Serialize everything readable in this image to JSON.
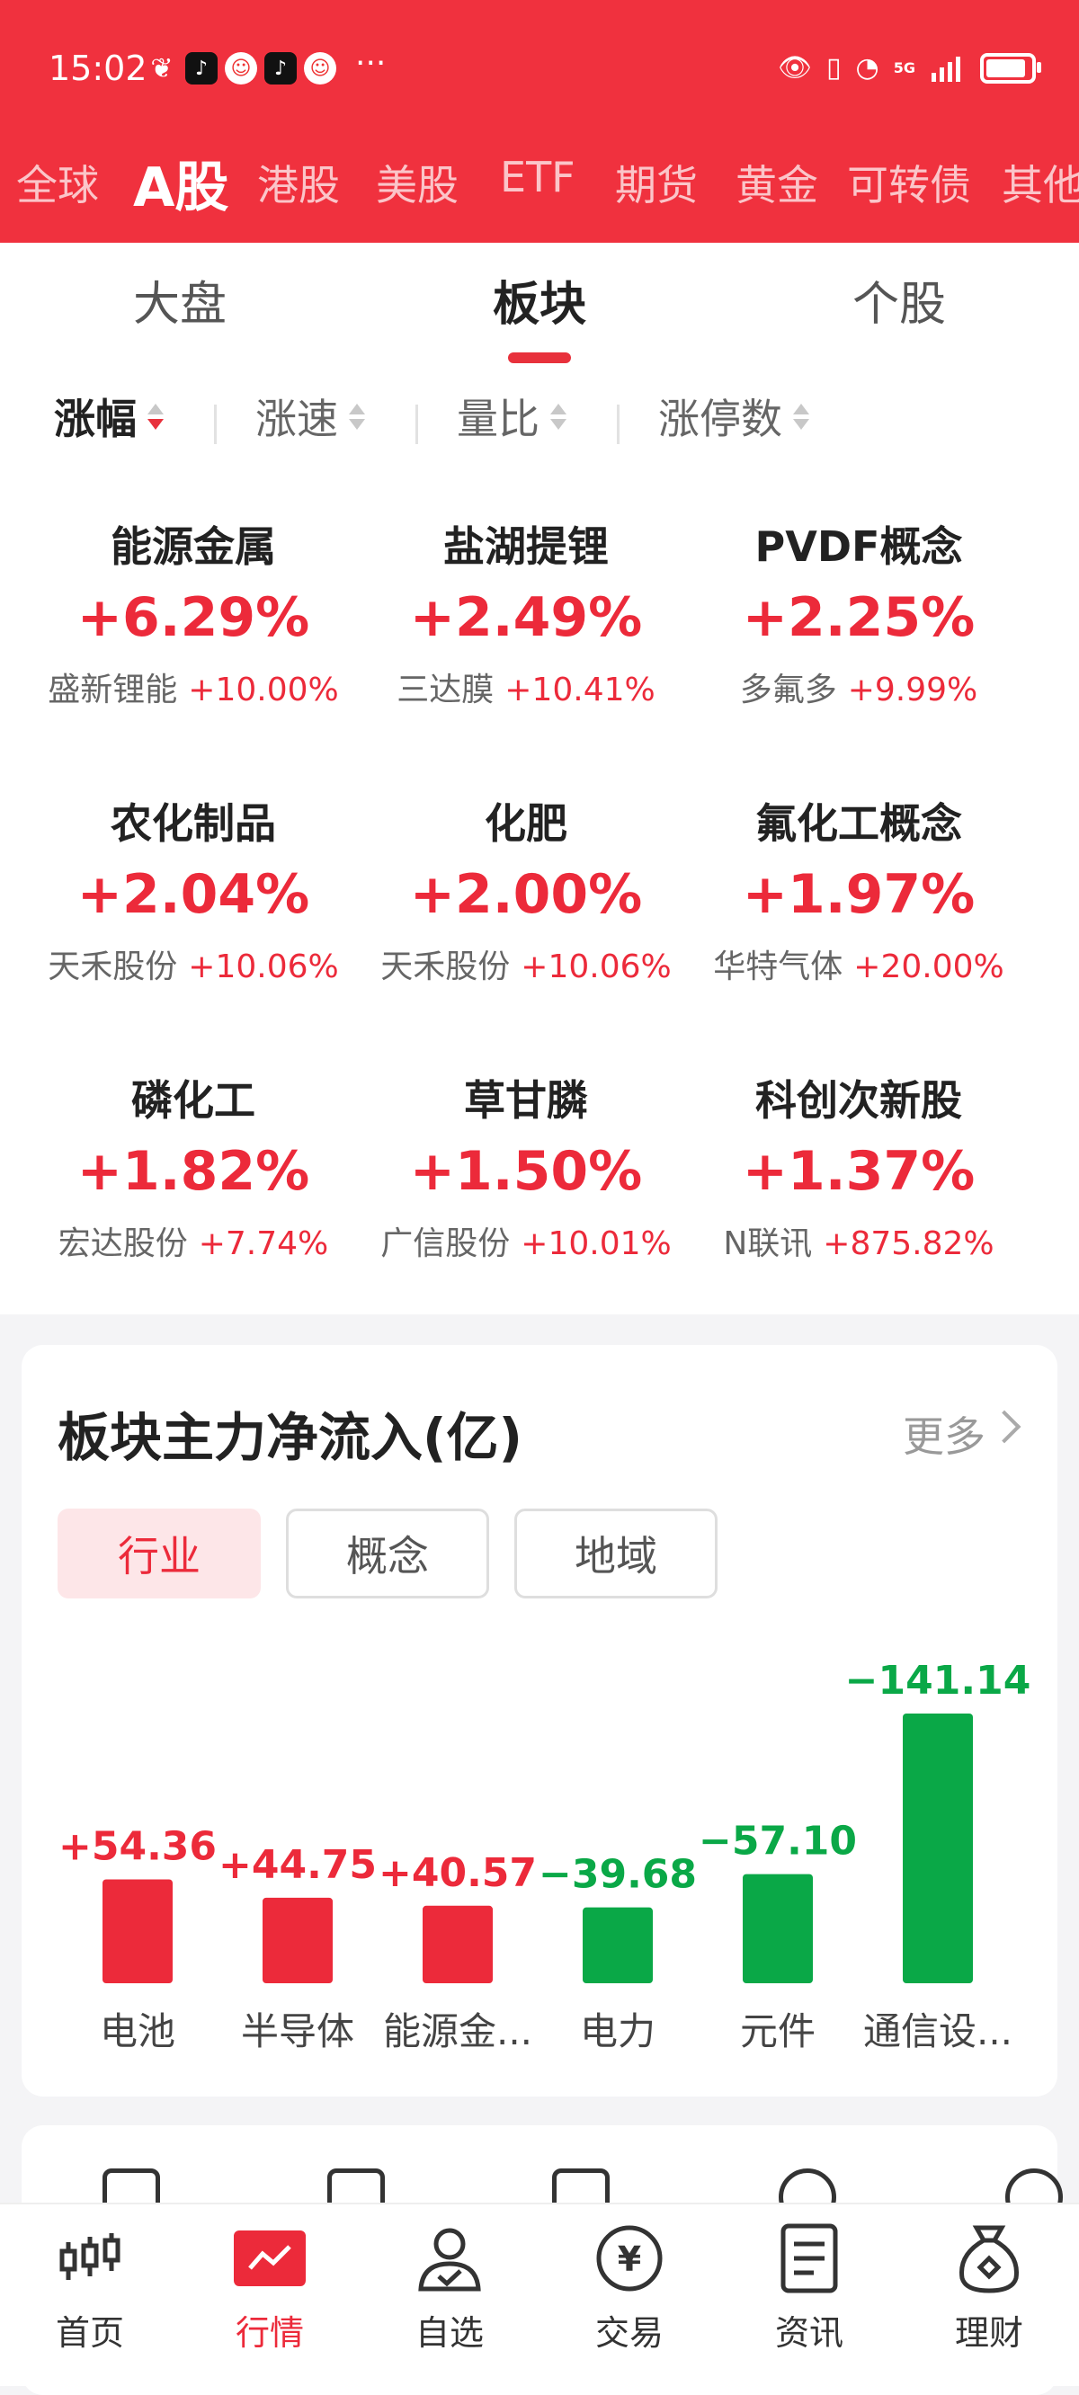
{
  "status_bar": {
    "time": "15:02",
    "more": "···",
    "network": "5G"
  },
  "market_tabs": [
    {
      "label": "全球",
      "active": false
    },
    {
      "label": "A股",
      "active": true
    },
    {
      "label": "港股",
      "active": false
    },
    {
      "label": "美股",
      "active": false
    },
    {
      "label": "ETF",
      "active": false
    },
    {
      "label": "期货",
      "active": false
    },
    {
      "label": "黄金",
      "active": false
    },
    {
      "label": "可转债",
      "active": false
    },
    {
      "label": "其他",
      "active": false
    }
  ],
  "seg_tabs": [
    {
      "label": "大盘",
      "active": false
    },
    {
      "label": "板块",
      "active": true
    },
    {
      "label": "个股",
      "active": false
    }
  ],
  "sort_options": [
    {
      "label": "涨幅",
      "active": true
    },
    {
      "label": "涨速",
      "active": false
    },
    {
      "label": "量比",
      "active": false
    },
    {
      "label": "涨停数",
      "active": false
    }
  ],
  "sectors": [
    {
      "name": "能源金属",
      "pct": "+6.29%",
      "leader": "盛新锂能",
      "leader_pct": "+10.00%"
    },
    {
      "name": "盐湖提锂",
      "pct": "+2.49%",
      "leader": "三达膜",
      "leader_pct": "+10.41%"
    },
    {
      "name": "PVDF概念",
      "pct": "+2.25%",
      "leader": "多氟多",
      "leader_pct": "+9.99%"
    },
    {
      "name": "农化制品",
      "pct": "+2.04%",
      "leader": "天禾股份",
      "leader_pct": "+10.06%"
    },
    {
      "name": "化肥",
      "pct": "+2.00%",
      "leader": "天禾股份",
      "leader_pct": "+10.06%"
    },
    {
      "name": "氟化工概念",
      "pct": "+1.97%",
      "leader": "华特气体",
      "leader_pct": "+20.00%"
    },
    {
      "name": "磷化工",
      "pct": "+1.82%",
      "leader": "宏达股份",
      "leader_pct": "+7.74%"
    },
    {
      "name": "草甘膦",
      "pct": "+1.50%",
      "leader": "广信股份",
      "leader_pct": "+10.01%"
    },
    {
      "name": "科创次新股",
      "pct": "+1.37%",
      "leader": "N联讯",
      "leader_pct": "+875.82%"
    }
  ],
  "fund_flow": {
    "title": "板块主力净流入(亿)",
    "more_label": "更多",
    "tabs": [
      {
        "label": "行业",
        "active": true
      },
      {
        "label": "概念",
        "active": false
      },
      {
        "label": "地域",
        "active": false
      }
    ]
  },
  "colors": {
    "brand_red": "#f0313e",
    "up_red": "#ec2a3a",
    "down_green": "#0aa847"
  },
  "chart_data": {
    "type": "bar",
    "categories": [
      "电池",
      "半导体",
      "能源金...",
      "电力",
      "元件",
      "通信设..."
    ],
    "values": [
      54.36,
      44.75,
      40.57,
      -39.68,
      -57.1,
      -141.14
    ],
    "labels": [
      "+54.36",
      "+44.75",
      "+40.57",
      "−39.68",
      "−57.10",
      "−141.14"
    ],
    "magnitude_bars": true,
    "title": "",
    "xlabel": "",
    "ylabel": ""
  },
  "bottom_nav": [
    {
      "label": "首页",
      "icon": "candlestick-icon",
      "active": false
    },
    {
      "label": "行情",
      "icon": "market-chart-icon",
      "active": true
    },
    {
      "label": "自选",
      "icon": "user-check-icon",
      "active": false
    },
    {
      "label": "交易",
      "icon": "yuan-coin-icon",
      "active": false
    },
    {
      "label": "资讯",
      "icon": "news-doc-icon",
      "active": false
    },
    {
      "label": "理财",
      "icon": "money-bag-icon",
      "active": false
    }
  ]
}
